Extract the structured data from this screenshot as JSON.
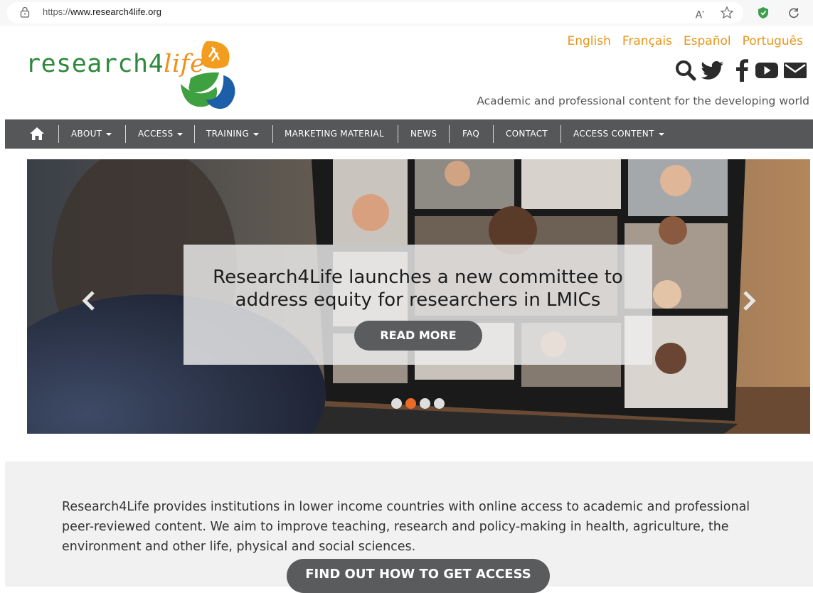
{
  "browser": {
    "url_prefix": "https://",
    "url_domain": "www.research4life.org",
    "icons": [
      "lock-icon",
      "read-aloud-icon",
      "favorite-star-icon",
      "shield-extension-icon",
      "refresh-icon"
    ]
  },
  "logo": {
    "text_main": "research4",
    "text_life": "life"
  },
  "languages": [
    "English",
    "Français",
    "Español",
    "Português"
  ],
  "social_icons": [
    "search-icon",
    "twitter-icon",
    "facebook-icon",
    "youtube-icon",
    "email-icon"
  ],
  "tagline": "Academic and professional content for the developing world",
  "nav": {
    "home_icon": "home-icon",
    "items": [
      {
        "label": "ABOUT",
        "dropdown": true
      },
      {
        "label": "ACCESS",
        "dropdown": true
      },
      {
        "label": "TRAINING",
        "dropdown": true
      },
      {
        "label": "MARKETING MATERIAL",
        "dropdown": false
      },
      {
        "label": "NEWS",
        "dropdown": false
      },
      {
        "label": "FAQ",
        "dropdown": false
      },
      {
        "label": "CONTACT",
        "dropdown": false
      },
      {
        "label": "ACCESS CONTENT",
        "dropdown": true
      }
    ]
  },
  "hero": {
    "title_line1": "Research4Life launches a new committee to",
    "title_line2": "address equity for researchers in LMICs",
    "button": "READ MORE",
    "slide_count": 4,
    "active_slide": 2
  },
  "intro": {
    "text": "Research4Life provides institutions in lower income countries with online access to academic and professional peer-reviewed content. We aim to improve teaching, research and policy-making in health, agriculture, the environment and other life, physical and social sciences.",
    "cta": "FIND OUT HOW TO GET ACCESS"
  },
  "colors": {
    "accent_orange": "#e8951a",
    "logo_green": "#2e8a3a",
    "nav_bg": "#555759",
    "active_dot": "#e96b28"
  }
}
